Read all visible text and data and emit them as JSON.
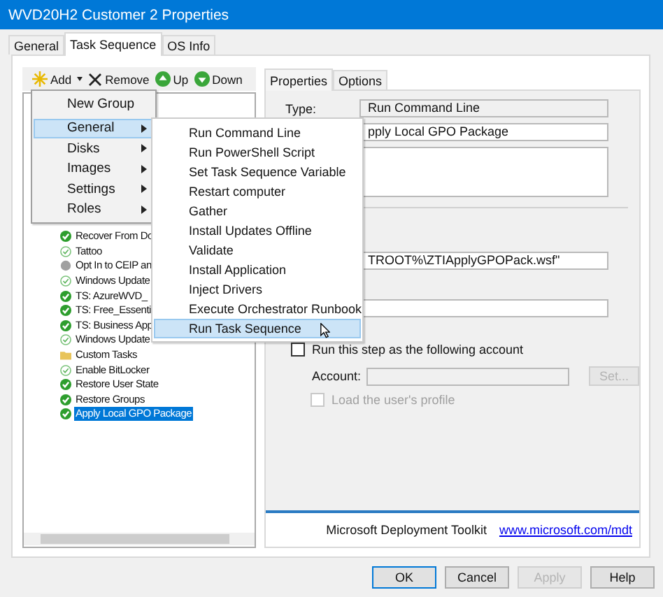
{
  "window": {
    "title": "WVD20H2 Customer 2 Properties"
  },
  "tabs": [
    {
      "label": "General",
      "selected": false
    },
    {
      "label": "Task Sequence",
      "selected": true
    },
    {
      "label": "OS Info",
      "selected": false
    }
  ],
  "toolbar": [
    {
      "label": "Add",
      "kind": "add"
    },
    {
      "label": "Remove",
      "kind": "remove"
    },
    {
      "label": "Up",
      "kind": "up"
    },
    {
      "label": "Down",
      "kind": "down"
    }
  ],
  "tree": {
    "items": [
      {
        "label": "Recover From Do",
        "kind": "success",
        "selected": false
      },
      {
        "label": "Tattoo",
        "kind": "light",
        "selected": false
      },
      {
        "label": "Opt In to CEIP an",
        "kind": "grey",
        "selected": false
      },
      {
        "label": "Windows Update",
        "kind": "light",
        "selected": false
      },
      {
        "label": "TS: AzureWVD_",
        "kind": "success",
        "selected": false
      },
      {
        "label": "TS: Free_Essenti",
        "kind": "success",
        "selected": false
      },
      {
        "label": "TS: Business App",
        "kind": "success",
        "selected": false
      },
      {
        "label": "Windows Update",
        "kind": "light",
        "selected": false
      },
      {
        "label": "Custom Tasks",
        "kind": "folder",
        "selected": false
      },
      {
        "label": "Enable BitLocker",
        "kind": "light",
        "selected": false
      },
      {
        "label": "Restore User State",
        "kind": "success",
        "selected": false
      },
      {
        "label": "Restore Groups",
        "kind": "success",
        "selected": false
      },
      {
        "label": "Apply Local GPO Package",
        "kind": "success",
        "selected": true
      }
    ]
  },
  "add_menu": {
    "items": [
      {
        "label": "New Group",
        "submenu": false,
        "selected": false
      },
      {
        "label": "General",
        "submenu": true,
        "selected": true
      },
      {
        "label": "Disks",
        "submenu": true,
        "selected": false
      },
      {
        "label": "Images",
        "submenu": true,
        "selected": false
      },
      {
        "label": "Settings",
        "submenu": true,
        "selected": false
      },
      {
        "label": "Roles",
        "submenu": true,
        "selected": false
      }
    ]
  },
  "submenu": {
    "items": [
      {
        "label": "Run Command Line",
        "selected": false
      },
      {
        "label": "Run PowerShell Script",
        "selected": false
      },
      {
        "label": "Set Task Sequence Variable",
        "selected": false
      },
      {
        "label": "Restart computer",
        "selected": false
      },
      {
        "label": "Gather",
        "selected": false
      },
      {
        "label": "Install Updates Offline",
        "selected": false
      },
      {
        "label": "Validate",
        "selected": false
      },
      {
        "label": "Install Application",
        "selected": false
      },
      {
        "label": "Inject Drivers",
        "selected": false
      },
      {
        "label": "Execute Orchestrator Runbook",
        "selected": false
      },
      {
        "label": "Run Task Sequence",
        "selected": true
      }
    ]
  },
  "properties_tabs": [
    {
      "label": "Properties",
      "selected": true
    },
    {
      "label": "Options",
      "selected": false
    }
  ],
  "properties": {
    "type_label": "Type:",
    "type_value": "Run Command Line",
    "name_value": "pply Local GPO Package",
    "command_value": "TROOT%\\ZTIApplyGPOPack.wsf\"",
    "run_as": {
      "label": "Run this step as the following account",
      "checked": false
    },
    "account_label": "Account:",
    "set_button": {
      "label": "Set...",
      "disabled": true
    },
    "load_profile": {
      "label": "Load the user's profile",
      "checked": false,
      "disabled": true
    }
  },
  "footer": {
    "text": "Microsoft Deployment Toolkit",
    "link": "www.microsoft.com/mdt"
  },
  "buttons": [
    {
      "label": "OK",
      "default": true,
      "disabled": false
    },
    {
      "label": "Cancel",
      "default": false,
      "disabled": false
    },
    {
      "label": "Apply",
      "default": false,
      "disabled": true
    },
    {
      "label": "Help",
      "default": false,
      "disabled": false
    }
  ]
}
